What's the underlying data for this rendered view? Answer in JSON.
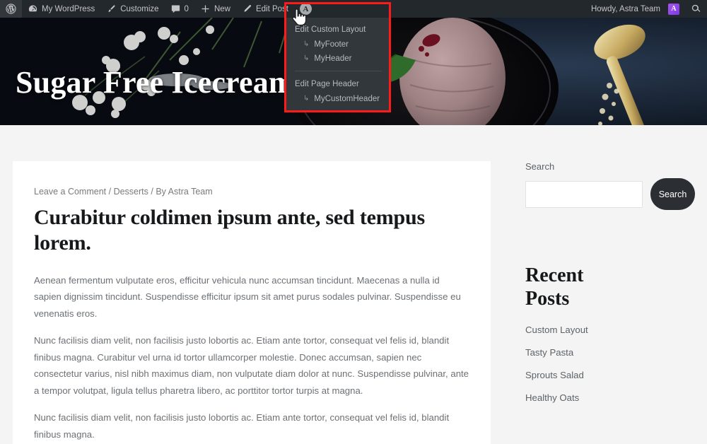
{
  "adminbar": {
    "wp_logo": "wordpress-logo-icon",
    "items": [
      {
        "label": "My WordPress",
        "icon": "dashboard-icon"
      },
      {
        "label": "Customize",
        "icon": "paintbrush-icon"
      },
      {
        "label": "0",
        "icon": "comment-bubble-icon"
      },
      {
        "label": "New",
        "icon": "plus-icon"
      },
      {
        "label": "Edit Post",
        "icon": "pencil-icon"
      }
    ],
    "astra_icon": "A",
    "howdy": "Howdy, Astra Team",
    "avatar_letter": "A",
    "search_icon": "search-icon"
  },
  "dropdown": {
    "arrow_glyph": "↳",
    "groups": [
      {
        "heading": "Edit Custom Layout",
        "items": [
          "MyFooter",
          "MyHeader"
        ]
      },
      {
        "heading": "Edit Page Header",
        "items": [
          "MyCustomHeader"
        ]
      }
    ]
  },
  "hero": {
    "title": "Sugar Free Icecream"
  },
  "post": {
    "meta_comment": "Leave a Comment",
    "sep1": " / ",
    "meta_category": "Desserts",
    "sep2": " / ",
    "meta_author": "By Astra Team",
    "title": "Curabitur coldimen ipsum ante, sed tempus lorem.",
    "paragraphs": [
      "Aenean fermentum vulputate eros, efficitur vehicula nunc accumsan tincidunt. Maecenas a nulla id sapien dignissim tincidunt. Suspendisse efficitur ipsum sit amet purus sodales pulvinar. Suspendisse eu venenatis eros.",
      "Nunc facilisis diam velit, non facilisis justo lobortis ac. Etiam ante tortor, consequat vel felis id, blandit finibus magna. Curabitur vel urna id tortor ullamcorper molestie. Donec accumsan, sapien nec consectetur varius, nisl nibh maximus diam, non vulputate diam dolor at nunc. Suspendisse pulvinar, ante a tempor volutpat, ligula tellus pharetra libero, ac porttitor tortor turpis at magna.",
      "Nunc facilisis diam velit, non facilisis justo lobortis ac. Etiam ante tortor, consequat vel felis id, blandit finibus magna."
    ]
  },
  "sidebar": {
    "search_label": "Search",
    "search_value": "",
    "search_placeholder": "",
    "search_button": "Search",
    "recent_posts_title": "Recent Posts",
    "recent_posts": [
      "Custom Layout",
      "Tasty Pasta",
      "Sprouts Salad",
      "Healthy Oats"
    ]
  },
  "colors": {
    "adminbar_bg": "#23282d",
    "dropdown_bg": "#32373c",
    "highlight": "#ff1a1a",
    "page_bg": "#f4f4f4",
    "card_bg": "#ffffff",
    "button_bg": "#2b2f33",
    "avatar": "#7c3aed"
  }
}
